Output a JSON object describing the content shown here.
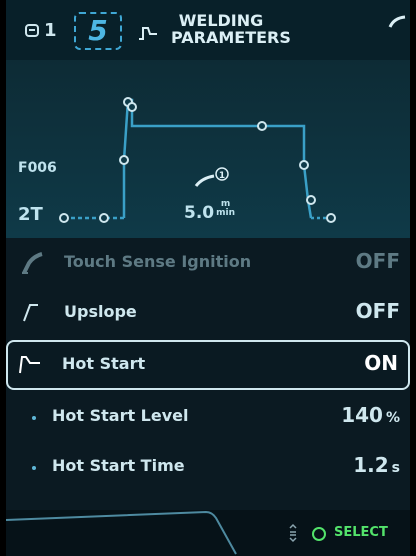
{
  "header": {
    "unit_id": "1",
    "job_number": "5",
    "title_line1": "WELDING",
    "title_line2": "PARAMETERS"
  },
  "graph": {
    "program": "F006",
    "mode": "2T",
    "wire_feed_value": "5.0",
    "wire_feed_unit_top": "m",
    "wire_feed_unit_bottom": "min",
    "wire_feed_index": "1"
  },
  "parameters": [
    {
      "label": "Touch Sense Ignition",
      "value": "OFF",
      "unit": "",
      "icon": "torch-icon",
      "state": "disabled"
    },
    {
      "label": "Upslope",
      "value": "OFF",
      "unit": "",
      "icon": "upslope-icon",
      "state": "normal"
    },
    {
      "label": "Hot Start",
      "value": "ON",
      "unit": "",
      "icon": "hot-start-icon",
      "state": "selected"
    },
    {
      "label": "Hot Start Level",
      "value": "140",
      "unit": "%",
      "icon": "bullet-icon",
      "state": "sub"
    },
    {
      "label": "Hot Start Time",
      "value": "1.2",
      "unit": "s",
      "icon": "bullet-icon",
      "state": "sub"
    }
  ],
  "footer": {
    "select_label": "SELECT"
  },
  "colors": {
    "accent": "#3fa7d4",
    "select_green": "#53e36b",
    "background": "#0b1a22"
  }
}
